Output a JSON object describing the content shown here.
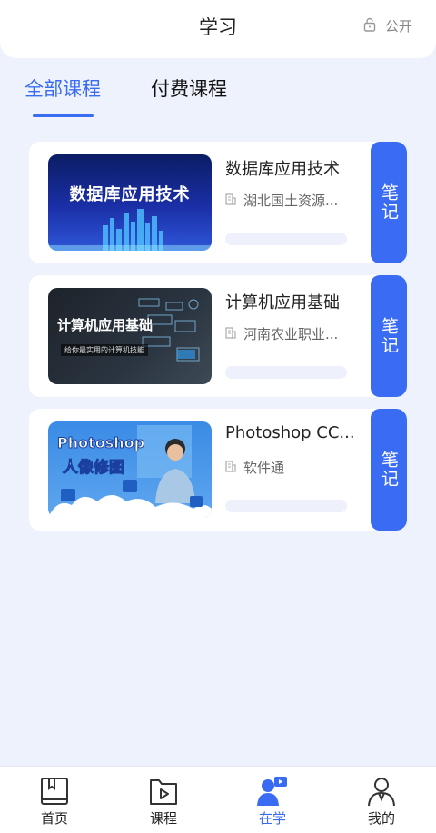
{
  "header": {
    "title": "学习",
    "public_label": "公开",
    "public_icon": "lock-icon"
  },
  "tabs": [
    {
      "label": "全部课程",
      "active": true
    },
    {
      "label": "付费课程",
      "active": false
    }
  ],
  "courses": [
    {
      "title": "数据库应用技术",
      "org": "湖北国土资源...",
      "thumb_text": "数据库应用技术",
      "note_label": "笔记",
      "org_icon": "building-icon"
    },
    {
      "title": "计算机应用基础",
      "org": "河南农业职业...",
      "thumb_text": "计算机应用基础",
      "thumb_sub": "给你最实用的计算机技能",
      "note_label": "笔记",
      "org_icon": "building-icon"
    },
    {
      "title": "Photoshop CC...",
      "org": "软件通",
      "thumb_text": "Photoshop",
      "thumb_sub": "人像修图",
      "note_label": "笔记",
      "org_icon": "building-icon"
    }
  ],
  "tabbar": {
    "items": [
      {
        "label": "首页",
        "icon": "book-icon",
        "active": false
      },
      {
        "label": "课程",
        "icon": "video-icon",
        "active": false
      },
      {
        "label": "在学",
        "icon": "study-user-icon",
        "active": true
      },
      {
        "label": "我的",
        "icon": "profile-icon",
        "active": false
      }
    ]
  },
  "colors": {
    "accent": "#3a6cf3",
    "background": "#eef2fd",
    "card": "#ffffff"
  }
}
